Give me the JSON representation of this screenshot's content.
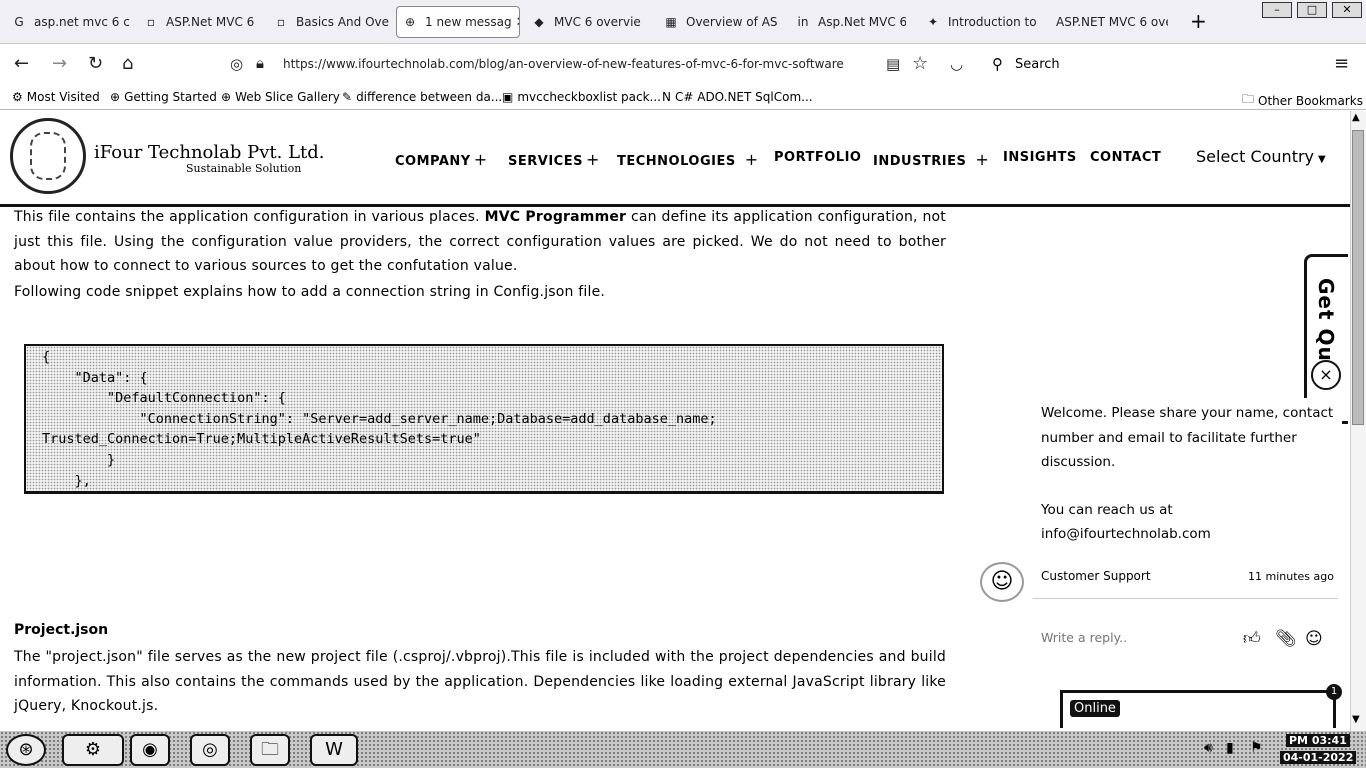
{
  "browser": {
    "tabs": [
      {
        "icon": "G",
        "label": "asp.net mvc 6 c"
      },
      {
        "icon": "▫",
        "label": "ASP.Net MVC 6"
      },
      {
        "icon": "▫",
        "label": "Basics And Ove"
      },
      {
        "icon": "⊕",
        "label": "1 new messag"
      },
      {
        "icon": "◆",
        "label": "MVC 6 overvie"
      },
      {
        "icon": "▦",
        "label": "Overview of AS"
      },
      {
        "icon": "in",
        "label": "Asp.Net MVC 6"
      },
      {
        "icon": "✦",
        "label": "Introduction to"
      },
      {
        "icon": "",
        "label": "ASP.NET MVC 6 ove"
      }
    ],
    "new_tab_symbol": "+",
    "url": "https://www.ifourtechnolab.com/blog/an-overview-of-new-features-of-mvc-6-for-mvc-software",
    "search_label": "Search",
    "bookmarks": [
      {
        "icon": "gear-icon",
        "label": "Most Visited"
      },
      {
        "icon": "globe-icon",
        "label": "Getting Started"
      },
      {
        "icon": "globe-icon",
        "label": "Web Slice Gallery"
      },
      {
        "icon": "pen-icon",
        "label": "difference between da..."
      },
      {
        "icon": "nuget-icon",
        "label": "mvccheckboxlist pack..."
      },
      {
        "icon": "csharp-icon",
        "label": "C# ADO.NET SqlCom..."
      }
    ],
    "other_bookmarks": "Other Bookmarks"
  },
  "site": {
    "brand_name": "iFour Technolab Pvt. Ltd.",
    "brand_tagline": "Sustainable Solution",
    "nav": [
      {
        "label": "COMPANY",
        "plus": "+"
      },
      {
        "label": "SERVICES",
        "plus": "+"
      },
      {
        "label": "TECHNOLOGIES",
        "plus": "+"
      },
      {
        "label": "PORTFOLIO",
        "plus": ""
      },
      {
        "label": "INDUSTRIES",
        "plus": "+"
      },
      {
        "label": "INSIGHTS",
        "plus": ""
      },
      {
        "label": "CONTACT",
        "plus": ""
      }
    ],
    "country_select": "Select Country"
  },
  "article": {
    "para1_before": "This file contains the application configuration in various places. ",
    "para1_bold": "MVC Programmer",
    "para1_after": " can define its application configuration, not just this file. Using the configuration value providers, the correct configuration values are picked. We do not need to bother about how to connect to various sources to get the confutation value.",
    "para2": "Following code snippet explains how to add a connection string in Config.json file.",
    "code_lines": [
      "{",
      "    \"Data\": {",
      "        \"DefaultConnection\": {",
      "            \"ConnectionString\": \"Server=add_server_name;Database=add_database_name;",
      "Trusted_Connection=True;MultipleActiveResultSets=true\"",
      "        }",
      "    },"
    ],
    "heading": "Project.json",
    "para3": "The \"project.json\" file serves as the new project file (.csproj/.vbproj).This file is included with the project dependencies and build information. This also contains the commands used by the application. Dependencies like loading external JavaScript library like jQuery, Knockout.js."
  },
  "get_quote": {
    "label": "Get Qu",
    "close": "×"
  },
  "chat": {
    "lines": [
      "Welcome. Please share your name, contact",
      "number and email to facilitate further",
      "discussion.",
      "",
      "You can reach us at",
      "info@ifourtechnolab.com"
    ],
    "agent_name": "Customer Support",
    "time_ago": "11 minutes ago",
    "reply_placeholder": "Write a reply..",
    "status_label": "Online",
    "badge_count": "1"
  },
  "taskbar": {
    "time": "PM 03:41",
    "date": "04-01-2022"
  }
}
